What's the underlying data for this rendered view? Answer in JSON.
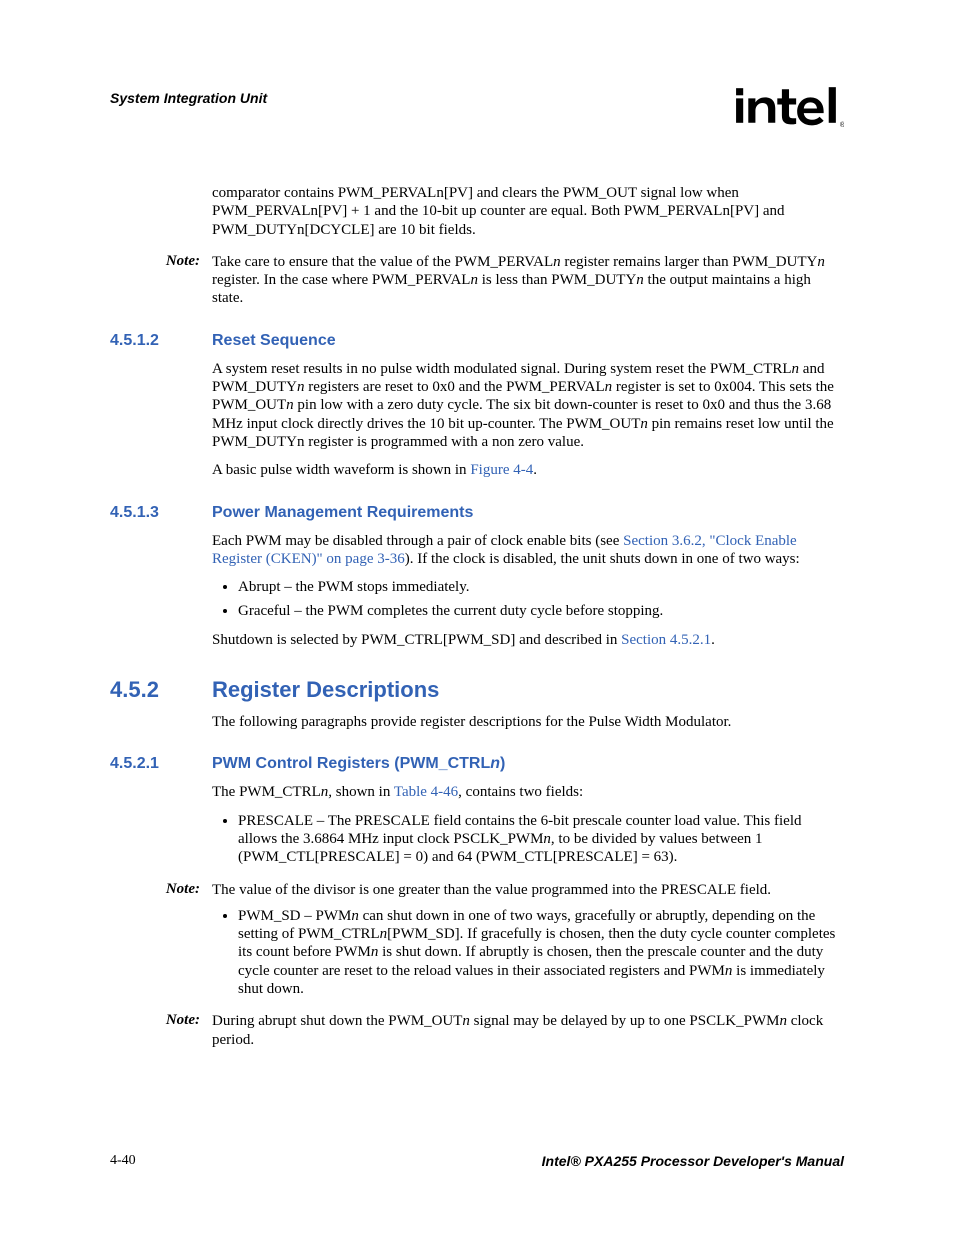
{
  "header": {
    "section_title": "System Integration Unit"
  },
  "intro": {
    "para1": "comparator contains PWM_PERVALn[PV] and clears the PWM_OUT signal low when PWM_PERVALn[PV] + 1 and the 10-bit up counter are equal. Both PWM_PERVALn[PV] and PWM_DUTYn[DCYCLE] are 10 bit fields."
  },
  "note1": {
    "label": "Note:",
    "text_a": "Take care to ensure that the value of the PWM_PERVAL",
    "text_b": " register remains larger than PWM_DUTY",
    "text_c": " register. In the case where PWM_PERVAL",
    "text_d": " is less than PWM_DUTY",
    "text_e": " the output maintains a high state.",
    "n": "n"
  },
  "s4512": {
    "num": "4.5.1.2",
    "title": "Reset Sequence",
    "para1_a": "A system reset results in no pulse width modulated signal. During system reset the PWM_CTRL",
    "para1_b": " and PWM_DUTY",
    "para1_c": " registers are reset to 0x0 and the PWM_PERVAL",
    "para1_d": " register is set to 0x004. This sets the PWM_OUT",
    "para1_e": " pin low with a zero duty cycle. The six bit down-counter is reset to 0x0 and thus the 3.68 MHz input clock directly drives the 10 bit up-counter. The PWM_OUT",
    "para1_f": " pin remains reset low until the PWM_DUTYn register is programmed with a non zero value.",
    "para2_a": "A basic pulse width waveform is shown in ",
    "para2_link": "Figure 4-4",
    "para2_b": ".",
    "n": "n"
  },
  "s4513": {
    "num": "4.5.1.3",
    "title": "Power Management Requirements",
    "para1_a": "Each PWM may be disabled through a pair of clock enable bits (see ",
    "para1_link": "Section 3.6.2, \"Clock Enable Register (CKEN)\" on page 3-36",
    "para1_b": "). If the clock is disabled, the unit shuts down in one of two ways:",
    "bullet1": "Abrupt – the PWM stops immediately.",
    "bullet2": "Graceful – the PWM completes the current duty cycle before stopping.",
    "para2_a": "Shutdown is selected by PWM_CTRL[PWM_SD] and described in ",
    "para2_link": "Section 4.5.2.1",
    "para2_b": "."
  },
  "s452": {
    "num": "4.5.2",
    "title": "Register Descriptions",
    "para1": "The following paragraphs provide register descriptions for the Pulse Width Modulator."
  },
  "s4521": {
    "num": "4.5.2.1",
    "title_a": "PWM Control Registers (PWM_CTRL",
    "title_n": "n",
    "title_b": ")",
    "para1_a": "The PWM_CTRL",
    "para1_b": " shown in ",
    "para1_link": "Table 4-46",
    "para1_c": ", contains two fields:",
    "n": "n,",
    "bullet1_a": "PRESCALE – The PRESCALE field contains the 6-bit prescale counter load value. This field allows the 3.6864 MHz input clock PSCLK_PWM",
    "bullet1_b": ", to be divided by values between 1 (PWM_CTL[PRESCALE] = 0) and 64 (PWM_CTL[PRESCALE] = 63).",
    "bn": "n"
  },
  "note2": {
    "label": "Note:",
    "text": "The value of the divisor is one greater than the value programmed into the PRESCALE field."
  },
  "bullet_sd": {
    "a": "PWM_SD – PWM",
    "b": " can shut down in one of two ways, gracefully or abruptly, depending on the setting of PWM_CTRL",
    "c": "[PWM_SD]. If gracefully is chosen, then the duty cycle counter completes its count before PWM",
    "d": " is shut down. If abruptly is chosen, then the prescale counter and the duty cycle counter are reset to the reload values in their associated registers and PWM",
    "e": " is immediately shut down.",
    "n": "n"
  },
  "note3": {
    "label": "Note:",
    "text_a": "During abrupt shut down the PWM_OUT",
    "text_b": " signal may be delayed by up to one PSCLK_PWM",
    "text_c": " clock period.",
    "n": "n"
  },
  "footer": {
    "page_num": "4-40",
    "manual": "Intel® PXA255 Processor Developer's Manual"
  }
}
